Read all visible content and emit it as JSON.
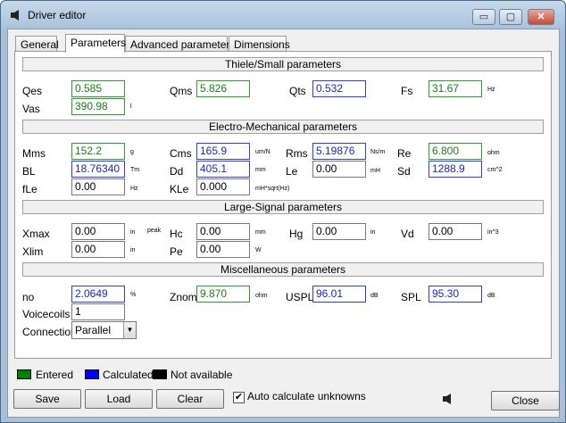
{
  "window": {
    "title": "Driver editor"
  },
  "titlebar_buttons": {
    "minimize": "▭",
    "maximize": "▢",
    "close": "✕"
  },
  "tabs": [
    "General",
    "Parameters",
    "Advanced parameters",
    "Dimensions"
  ],
  "sections": {
    "ts": "Thiele/Small parameters",
    "em": "Electro-Mechanical parameters",
    "ls": "Large-Signal parameters",
    "misc": "Miscellaneous parameters"
  },
  "params": {
    "qes": {
      "label": "Qes",
      "value": "0.585",
      "unit": ""
    },
    "qms": {
      "label": "Qms",
      "value": "5.826",
      "unit": ""
    },
    "qts": {
      "label": "Qts",
      "value": "0.532",
      "unit": ""
    },
    "fs": {
      "label": "Fs",
      "value": "31.67",
      "unit": "Hz"
    },
    "vas": {
      "label": "Vas",
      "value": "390.98",
      "unit": "l"
    },
    "mms": {
      "label": "Mms",
      "value": "152.2",
      "unit": "g"
    },
    "cms": {
      "label": "Cms",
      "value": "165.9",
      "unit": "um/N"
    },
    "rms": {
      "label": "Rms",
      "value": "5.19876",
      "unit": "Ns/m"
    },
    "re": {
      "label": "Re",
      "value": "6.800",
      "unit": "ohm"
    },
    "bl": {
      "label": "BL",
      "value": "18.76340",
      "unit": "Tm"
    },
    "dd": {
      "label": "Dd",
      "value": "405.1",
      "unit": "mm"
    },
    "le": {
      "label": "Le",
      "value": "0.00",
      "unit": "mH"
    },
    "sd": {
      "label": "Sd",
      "value": "1288.9",
      "unit": "cm^2"
    },
    "fle": {
      "label": "fLe",
      "value": "0.00",
      "unit": "Hz"
    },
    "kle": {
      "label": "KLe",
      "value": "0.000",
      "unit": "mH*sqrt(Hz)"
    },
    "xmax": {
      "label": "Xmax",
      "value": "0.00",
      "unit": "in",
      "extra": "peak"
    },
    "hc": {
      "label": "Hc",
      "value": "0.00",
      "unit": "mm"
    },
    "hg": {
      "label": "Hg",
      "value": "0.00",
      "unit": "in"
    },
    "vd": {
      "label": "Vd",
      "value": "0.00",
      "unit": "in^3"
    },
    "xlim": {
      "label": "Xlim",
      "value": "0.00",
      "unit": "in"
    },
    "pe": {
      "label": "Pe",
      "value": "0.00",
      "unit": "W"
    },
    "no": {
      "label": "no",
      "value": "2.0649",
      "unit": "%"
    },
    "znom": {
      "label": "Znom",
      "value": "9.870",
      "unit": "ohm"
    },
    "uspl": {
      "label": "USPL",
      "value": "96.01",
      "unit": "dB"
    },
    "spl": {
      "label": "SPL",
      "value": "95.30",
      "unit": "dB"
    },
    "voicecoils": {
      "label": "Voicecoils",
      "value": "1"
    },
    "connection": {
      "label": "Connection",
      "value": "Parallel"
    }
  },
  "legend": {
    "entered": {
      "label": "Entered",
      "color": "#008000"
    },
    "calculated": {
      "label": "Calculated",
      "color": "#0000ff"
    },
    "na": {
      "label": "Not available",
      "color": "#000000"
    }
  },
  "buttons": {
    "save": "Save",
    "load": "Load",
    "clear": "Clear",
    "auto_calc": "Auto calculate unknowns",
    "auto_calc_checked": "✔",
    "close": "Close"
  },
  "colors": {
    "entered": "#2f9a2f",
    "calculated": "#2b3fd0",
    "panel": "#f0f0f0"
  },
  "icons": {
    "app": "speaker-icon"
  }
}
